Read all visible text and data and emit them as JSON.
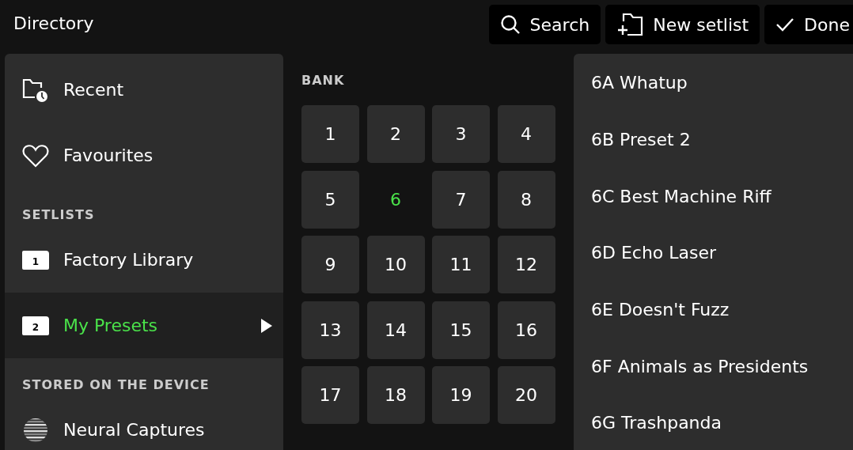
{
  "header": {
    "title": "Directory",
    "buttons": [
      {
        "kind": "search",
        "label": "Search"
      },
      {
        "kind": "new",
        "label": "New setlist"
      },
      {
        "kind": "done",
        "label": "Done"
      }
    ]
  },
  "sidebar": {
    "sections": [
      {
        "items": [
          {
            "kind": "recent",
            "label": "Recent",
            "selected": false
          },
          {
            "kind": "favourites",
            "label": "Favourites",
            "selected": false
          }
        ]
      },
      {
        "heading": "SETLISTS",
        "items": [
          {
            "kind": "setlist",
            "badge": "1",
            "label": "Factory Library",
            "selected": false
          },
          {
            "kind": "setlist",
            "badge": "2",
            "label": "My Presets",
            "selected": true
          }
        ]
      },
      {
        "heading": "STORED ON THE DEVICE",
        "items": [
          {
            "kind": "captures",
            "label": "Neural Captures",
            "selected": false
          }
        ]
      }
    ]
  },
  "bank": {
    "heading": "BANK",
    "tiles": [
      {
        "label": "1",
        "selected": false
      },
      {
        "label": "2",
        "selected": false
      },
      {
        "label": "3",
        "selected": false
      },
      {
        "label": "4",
        "selected": false
      },
      {
        "label": "5",
        "selected": false
      },
      {
        "label": "6",
        "selected": true
      },
      {
        "label": "7",
        "selected": false
      },
      {
        "label": "8",
        "selected": false
      },
      {
        "label": "9",
        "selected": false
      },
      {
        "label": "10",
        "selected": false
      },
      {
        "label": "11",
        "selected": false
      },
      {
        "label": "12",
        "selected": false
      },
      {
        "label": "13",
        "selected": false
      },
      {
        "label": "14",
        "selected": false
      },
      {
        "label": "15",
        "selected": false
      },
      {
        "label": "16",
        "selected": false
      },
      {
        "label": "17",
        "selected": false
      },
      {
        "label": "18",
        "selected": false
      },
      {
        "label": "19",
        "selected": false
      },
      {
        "label": "20",
        "selected": false
      }
    ]
  },
  "presets": [
    "6A Whatup",
    "6B Preset 2",
    "6C Best Machine Riff",
    "6D Echo Laser",
    "6E Doesn't Fuzz",
    "6F Animals as Presidents",
    "6G Trashpanda"
  ]
}
